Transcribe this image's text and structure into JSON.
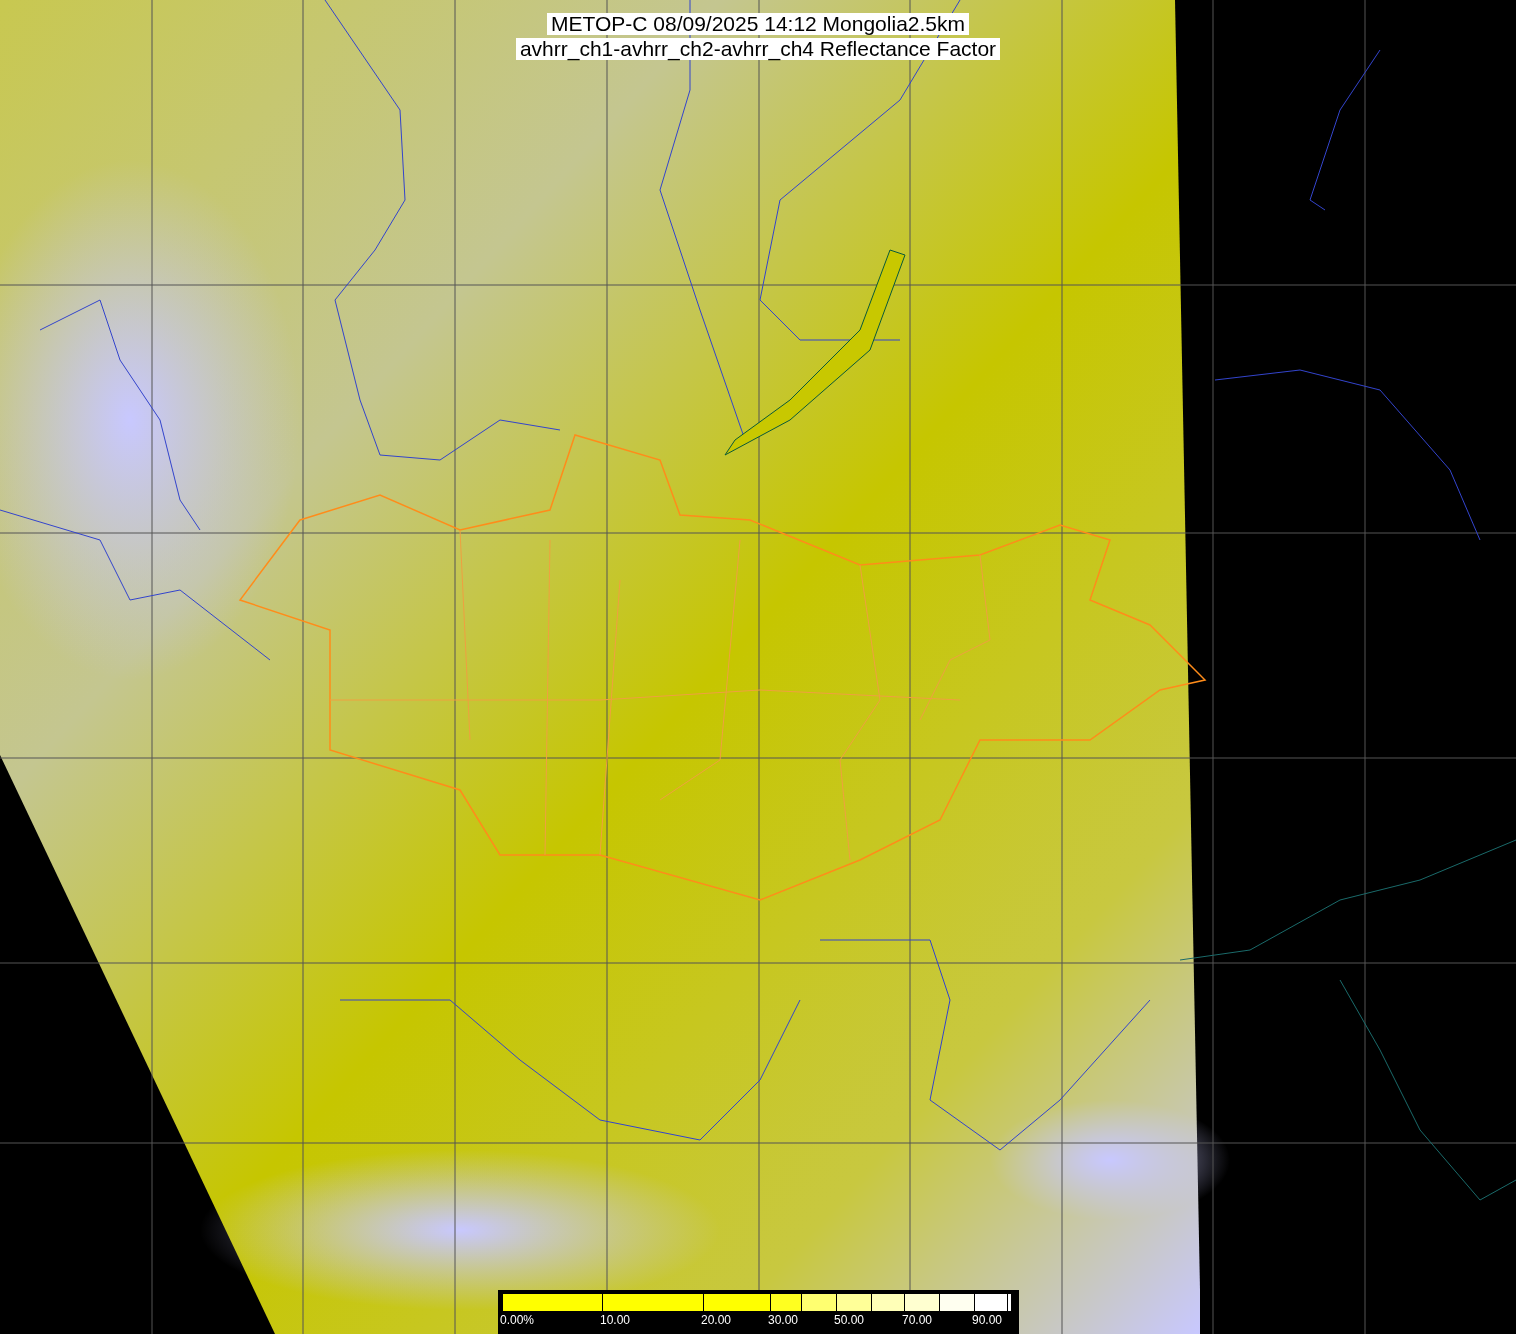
{
  "title": {
    "lines": [
      "METOP-C 08/09/2025 14:12 Mongolia2.5km",
      "avhrr_ch1-avhrr_ch2-avhrr_ch4 Reflectance Factor"
    ]
  },
  "colorbar": {
    "segments": [
      {
        "color": "#ffff00",
        "tick_label": "0.00%"
      },
      {
        "color": "#ffff00",
        "tick_label": "10.00"
      },
      {
        "color": "#ffff00",
        "tick_label": "20.00"
      },
      {
        "color": "#ffff20",
        "tick_label": "30.00"
      },
      {
        "color": "#ffff70"
      },
      {
        "color": "#ffff98",
        "tick_label": "50.00"
      },
      {
        "color": "#ffffb8"
      },
      {
        "color": "#ffffd0",
        "tick_label": "70.00"
      },
      {
        "color": "#fffff0"
      },
      {
        "color": "#ffffff",
        "tick_label": "90.00"
      },
      {
        "color": "#ffffff"
      }
    ]
  }
}
